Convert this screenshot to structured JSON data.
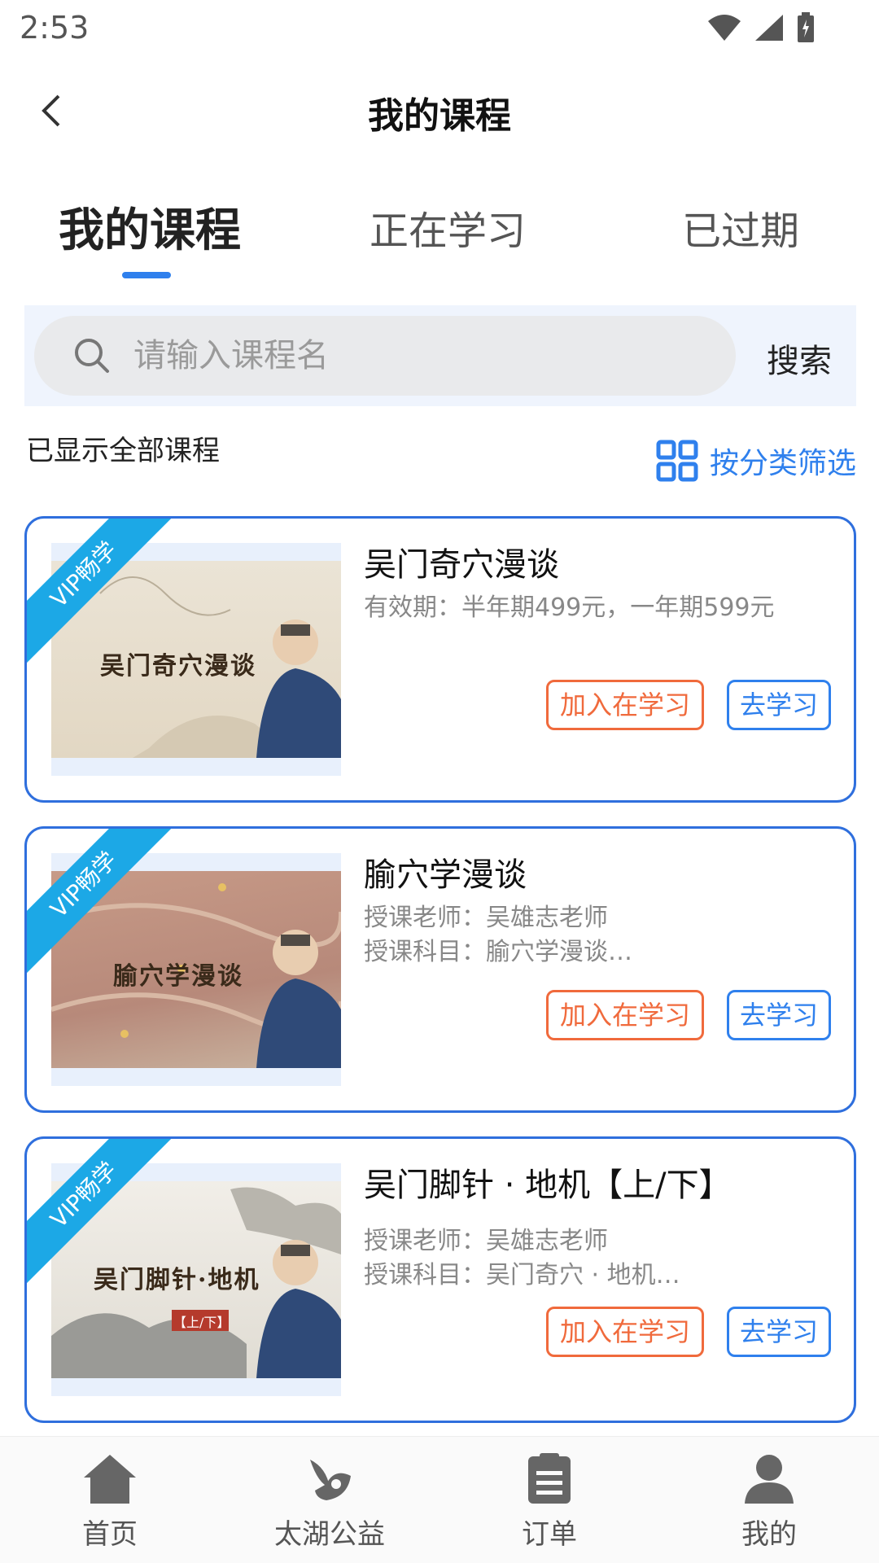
{
  "status_bar": {
    "time": "2:53"
  },
  "header": {
    "title": "我的课程"
  },
  "tabs": [
    {
      "label": "我的课程",
      "active": true
    },
    {
      "label": "正在学习",
      "active": false
    },
    {
      "label": "已过期",
      "active": false
    }
  ],
  "search": {
    "placeholder": "请输入课程名",
    "value": "",
    "button_label": "搜索"
  },
  "info": {
    "shown_all": "已显示全部课程",
    "filter_label": "按分类筛选"
  },
  "courses": [
    {
      "badge": "VIP畅学",
      "thumb_title": "吴门奇穴漫谈",
      "title": "吴门奇穴漫谈",
      "sub1": "有效期：半年期499元，一年期599元",
      "sub2": "",
      "join_label": "加入在学习",
      "learn_label": "去学习"
    },
    {
      "badge": "VIP畅学",
      "thumb_title": "腧穴学漫谈",
      "title": "腧穴学漫谈",
      "sub1": "授课老师：吴雄志老师",
      "sub2": "授课科目：腧穴学漫谈…",
      "join_label": "加入在学习",
      "learn_label": "去学习"
    },
    {
      "badge": "VIP畅学",
      "thumb_title": "吴门脚针·地机",
      "title": "吴门脚针 · 地机【上/下】",
      "sub1": "授课老师：吴雄志老师",
      "sub2": "授课科目：吴门奇穴 · 地机…",
      "join_label": "加入在学习",
      "learn_label": "去学习",
      "thumb_tag": "【上/下】"
    }
  ],
  "bottom_nav": [
    {
      "label": "首页",
      "icon": "home-icon"
    },
    {
      "label": "太湖公益",
      "icon": "charity-icon"
    },
    {
      "label": "订单",
      "icon": "order-icon"
    },
    {
      "label": "我的",
      "icon": "user-icon"
    }
  ],
  "colors": {
    "accent": "#2f80ed",
    "join": "#f06a3c",
    "card_border": "#2f6fdd",
    "ribbon": "#1ca8e6"
  }
}
